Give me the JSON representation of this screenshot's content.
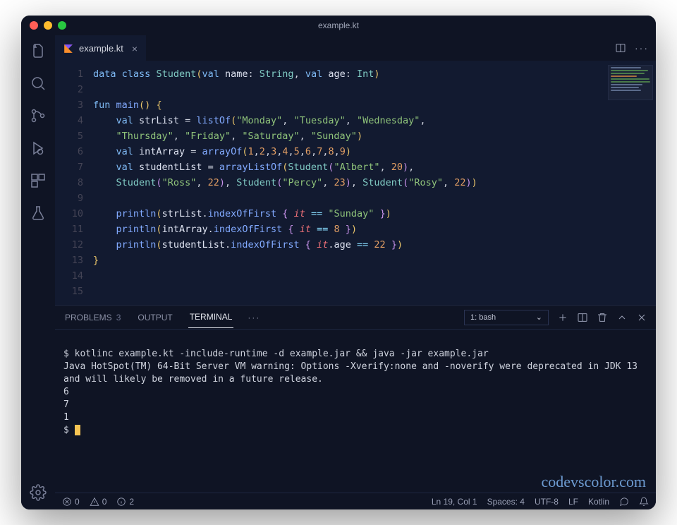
{
  "window_title": "example.kt",
  "tab": {
    "filename": "example.kt"
  },
  "code_lines": 15,
  "code": {
    "l1": {
      "p": [
        "data",
        " ",
        "class",
        " ",
        "Student",
        "(",
        "val",
        " ",
        "name",
        ": ",
        "String",
        ", ",
        "val",
        " ",
        "age",
        ": ",
        "Int",
        ")"
      ]
    },
    "l3a": "fun",
    "l3b": "main",
    "l3c": "() {",
    "l4": {
      "kw": "val",
      "id": "strList",
      "op": " = ",
      "fn": "listOf",
      "args": [
        "\"Monday\"",
        "\"Tuesday\"",
        "\"Wednesday\""
      ]
    },
    "l5": {
      "args": [
        "\"Thursday\"",
        "\"Friday\"",
        "\"Saturday\"",
        "\"Sunday\""
      ]
    },
    "l6": {
      "kw": "val",
      "id": "intArray",
      "op": " = ",
      "fn": "arrayOf",
      "nums": [
        "1",
        "2",
        "3",
        "4",
        "5",
        "6",
        "7",
        "8",
        "9"
      ]
    },
    "l7": {
      "kw": "val",
      "id": "studentList",
      "op": " = ",
      "fn": "arrayListOf",
      "student": "Student",
      "name": "\"Albert\"",
      "age": "20"
    },
    "l8": {
      "students": [
        [
          "\"Ross\"",
          "22"
        ],
        [
          "\"Percy\"",
          "23"
        ],
        [
          "\"Rosy\"",
          "22"
        ]
      ]
    },
    "l10": {
      "fn": "println",
      "obj": "strList",
      "m": "indexOfFirst",
      "cmp": "\"Sunday\""
    },
    "l11": {
      "fn": "println",
      "obj": "intArray",
      "m": "indexOfFirst",
      "cmp": "8"
    },
    "l12": {
      "fn": "println",
      "obj": "studentList",
      "m": "indexOfFirst",
      "prop": "age",
      "cmp": "22"
    }
  },
  "panel": {
    "tabs": {
      "problems": "PROBLEMS",
      "problems_count": "3",
      "output": "OUTPUT",
      "terminal": "TERMINAL"
    },
    "shell_label": "1: bash"
  },
  "terminal": {
    "cmd": "$ kotlinc example.kt -include-runtime -d example.jar && java -jar example.jar",
    "warn": "Java HotSpot(TM) 64-Bit Server VM warning: Options -Xverify:none and -noverify were deprecated in JDK 13 and will likely be removed in a future release.",
    "out1": "6",
    "out2": "7",
    "out3": "1",
    "prompt": "$ "
  },
  "watermark": "codevscolor.com",
  "status": {
    "errors": "0",
    "warnings": "0",
    "info": "2",
    "position": "Ln 19, Col 1",
    "spaces": "Spaces: 4",
    "encoding": "UTF-8",
    "eol": "LF",
    "lang": "Kotlin"
  }
}
